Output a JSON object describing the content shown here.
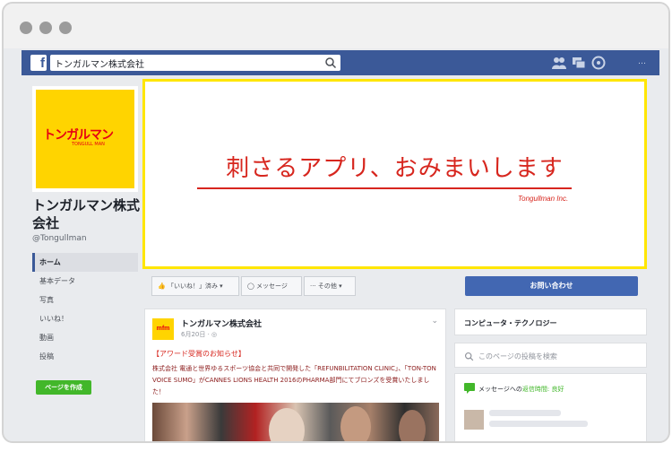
{
  "topbar": {
    "search_value": "トンガルマン株式会社",
    "account_label": "…",
    "logo_letter": "f"
  },
  "page": {
    "name": "トンガルマン株式会社",
    "handle": "@Tongullman",
    "logo_text": "トンガルマン",
    "logo_sub": "TONGULL MAN",
    "create_page_label": "ページを作成"
  },
  "nav": {
    "items": [
      {
        "label": "ホーム"
      },
      {
        "label": "基本データ"
      },
      {
        "label": "写真"
      },
      {
        "label": "いいね！"
      },
      {
        "label": "動画"
      },
      {
        "label": "投稿"
      }
    ]
  },
  "cover": {
    "headline": "刺さるアプリ、おみまいします",
    "brand": "Tongullman Inc."
  },
  "actions": {
    "like_label": "「いいね！」済み ▾",
    "message_label": "◯ メッセージ",
    "more_label": "··· その他 ▾",
    "contact_label": "お問い合わせ"
  },
  "post": {
    "avatar_text": "mfm",
    "author": "トンガルマン株式会社",
    "date": "6月20日 · ◎",
    "heading": "【アワード受賞のお知らせ】",
    "body": "株式会社 電通と世界ゆるスポーツ協会と共同で開発した「REFUNBILITATION CLINIC」、「TON-TON VOICE SUMO」がCANNES LIONS HEALTH 2016のPHARMA部門にてブロンズを受賞いたしました！"
  },
  "sidebar": {
    "category_title": "コンピュータ・テクノロジー",
    "search_placeholder": "このページの投稿を検索",
    "message_prefix": "メッセージへの",
    "message_accent": "返信時間: 良好"
  },
  "colors": {
    "fb_blue": "#3b5998",
    "brand_yellow": "#ffd400",
    "brand_red": "#d7261e",
    "create_green": "#42b72a",
    "contact_blue": "#4267b2"
  }
}
